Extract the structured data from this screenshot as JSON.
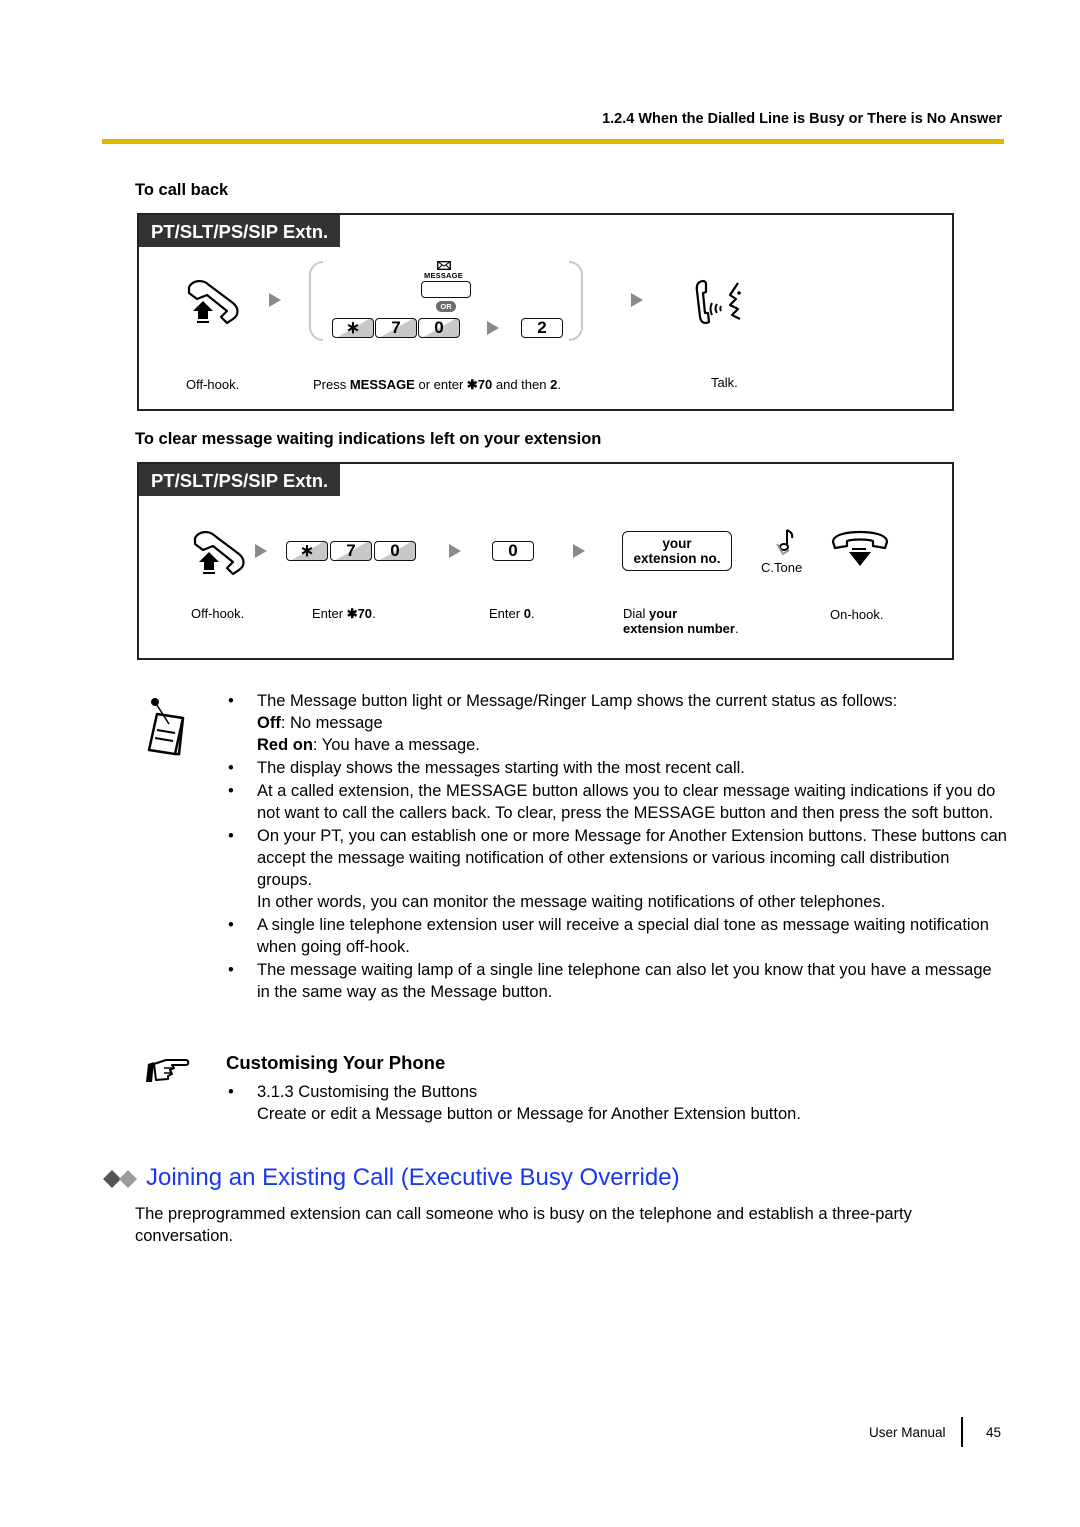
{
  "header": {
    "running_head": "1.2.4 When the Dialled Line is Busy or There is No Answer",
    "accent_color": "#e1b800"
  },
  "call_back": {
    "heading": "To call back",
    "panel_tag": "PT/SLT/PS/SIP Extn.",
    "steps": {
      "offhook_caption": "Off-hook.",
      "message_label": "MESSAGE",
      "or_label": "OR",
      "keys": [
        "※",
        "7",
        "0"
      ],
      "key_star": "∗",
      "key_7": "7",
      "key_0": "0",
      "key_2": "2",
      "press_caption_1": "Press ",
      "press_caption_message": "MESSAGE",
      "press_caption_2": " or enter ",
      "press_caption_code": "✱70",
      "press_caption_3": " and then ",
      "press_caption_2b": "2",
      "press_caption_4": ".",
      "talk_caption": "Talk."
    },
    "icons": [
      "offhook-icon",
      "message-envelope-icon",
      "talk-icon"
    ]
  },
  "clear_msg": {
    "heading": "To clear message waiting indications left on your extension",
    "panel_tag": "PT/SLT/PS/SIP Extn.",
    "steps": {
      "offhook_caption": "Off-hook.",
      "key_star": "∗",
      "key_7": "7",
      "key_0": "0",
      "key_0b": "0",
      "enter_caption_1": "Enter ",
      "enter_caption_code": "✱70",
      "enter_caption_end": ".",
      "enter0_caption_1": "Enter ",
      "enter0_caption_code": "0",
      "enter0_caption_end": ".",
      "ext_box_line1": "your",
      "ext_box_line2": "extension no.",
      "ctone_label": "C.Tone",
      "dial_caption_1": "Dial ",
      "dial_caption_bold1": "your",
      "dial_caption_bold2": "extension number",
      "dial_caption_end": ".",
      "onhook_caption": "On-hook."
    },
    "icons": [
      "offhook-icon",
      "confirmation-tone-icon",
      "onhook-icon"
    ]
  },
  "notes": {
    "icon": "notepad-icon",
    "items": [
      {
        "text": "The Message button light or Message/Ringer Lamp shows the current status as follows:",
        "sub": [
          {
            "label": "Off",
            "text": ": No message"
          },
          {
            "label": "Red on",
            "text": ": You have a message."
          }
        ]
      },
      {
        "text": "The display shows the messages starting with the most recent call."
      },
      {
        "text": "At a called extension, the MESSAGE button allows you to clear message waiting indications if you do not want to call the callers back. To clear, press the MESSAGE button and then press the soft button."
      },
      {
        "text": "On your PT, you can establish one or more Message for Another Extension buttons. These buttons can accept the message waiting notification of other extensions or various incoming call distribution groups.",
        "extra": "In other words, you can monitor the message waiting notifications of other telephones."
      },
      {
        "text": "A single line telephone extension user will receive a special dial tone as message waiting notification when going off-hook."
      },
      {
        "text": "The message waiting lamp of a single line telephone can also let you know that you have a message in the same way as the Message button."
      }
    ]
  },
  "customising": {
    "icon": "pointing-hand-icon",
    "title": "Customising Your Phone",
    "link": "3.1.3  Customising the Buttons",
    "desc": "Create or edit a Message button or Message for Another Extension button."
  },
  "section": {
    "icon": "double-diamond-icon",
    "title": "Joining an Existing Call (Executive Busy Override)",
    "title_color": "#1a37f0",
    "body": "The preprogrammed extension can call someone who is busy on the telephone and establish a three-party conversation."
  },
  "footer": {
    "label": "User Manual",
    "page": "45"
  }
}
